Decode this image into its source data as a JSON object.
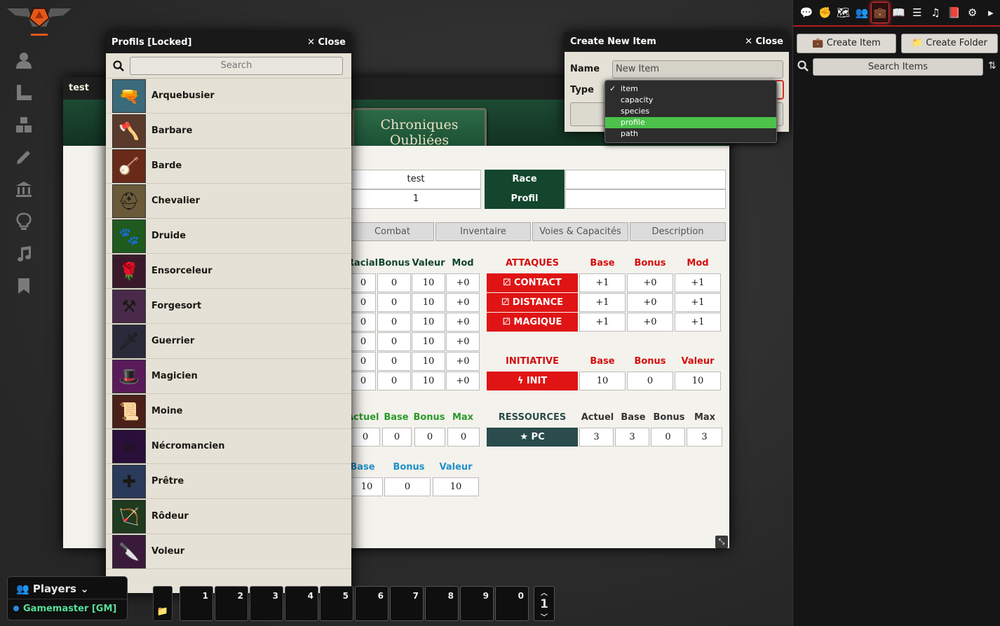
{
  "colors": {
    "accent_red": "#d40e0e",
    "sheet_green": "#13462d",
    "selected_green": "#4cc24a"
  },
  "sheet": {
    "title": "test",
    "logo_line1": "Chroniques",
    "logo_line2": "Oubliées",
    "name_value": "test",
    "level_value": "1",
    "race_label": "Race",
    "profil_label": "Profil",
    "race_value": "",
    "profil_value": "",
    "tabs": [
      "Combat",
      "Inventaire",
      "Voies & Capacités",
      "Description"
    ],
    "stats_headers": [
      "Racial",
      "Bonus",
      "Valeur",
      "Mod"
    ],
    "stats_rows": [
      [
        "0",
        "0",
        "10",
        "+0"
      ],
      [
        "0",
        "0",
        "10",
        "+0"
      ],
      [
        "0",
        "0",
        "10",
        "+0"
      ],
      [
        "0",
        "0",
        "10",
        "+0"
      ],
      [
        "0",
        "0",
        "10",
        "+0"
      ],
      [
        "0",
        "0",
        "10",
        "+0"
      ]
    ],
    "attack_headers": {
      "title": "ATTAQUES",
      "base": "Base",
      "bonus": "Bonus",
      "mod": "Mod"
    },
    "attacks": [
      {
        "label": "CONTACT",
        "base": "+1",
        "bonus": "+0",
        "mod": "+1"
      },
      {
        "label": "DISTANCE",
        "base": "+1",
        "bonus": "+0",
        "mod": "+1"
      },
      {
        "label": "MAGIQUE",
        "base": "+1",
        "bonus": "+0",
        "mod": "+1"
      }
    ],
    "init_headers": {
      "title": "INITIATIVE",
      "base": "Base",
      "bonus": "Bonus",
      "valeur": "Valeur"
    },
    "init": {
      "label": "INIT",
      "base": "10",
      "bonus": "0",
      "valeur": "10"
    },
    "hp_headers": [
      "Actuel",
      "Base",
      "Bonus",
      "Max"
    ],
    "hp_values": [
      "0",
      "0",
      "0",
      "0"
    ],
    "res_headers": {
      "title": "RESSOURCES",
      "actuel": "Actuel",
      "base": "Base",
      "bonus": "Bonus",
      "max": "Max"
    },
    "res": {
      "label": "PC",
      "actuel": "3",
      "base": "3",
      "bonus": "0",
      "max": "3"
    },
    "def_headers": [
      "Base",
      "Bonus",
      "Valeur"
    ],
    "def_values": [
      "10",
      "0",
      "10"
    ]
  },
  "profils": {
    "title": "Profils [Locked]",
    "close": "Close",
    "search_placeholder": "Search",
    "items": [
      {
        "name": "Arquebusier",
        "icon": "pistol-icon",
        "glyph": "🔫",
        "color": "#3b6a7a"
      },
      {
        "name": "Barbare",
        "icon": "axe-icon",
        "glyph": "🪓",
        "color": "#5a3a2a"
      },
      {
        "name": "Barde",
        "icon": "lute-icon",
        "glyph": "🪕",
        "color": "#6a2a1a"
      },
      {
        "name": "Chevalier",
        "icon": "helmet-icon",
        "glyph": "⛑",
        "color": "#6a5a3a"
      },
      {
        "name": "Druide",
        "icon": "paw-icon",
        "glyph": "🐾",
        "color": "#1f5a1f"
      },
      {
        "name": "Ensorceleur",
        "icon": "rose-staff-icon",
        "glyph": "🌹",
        "color": "#3a1a2a"
      },
      {
        "name": "Forgesort",
        "icon": "anvil-icon",
        "glyph": "⚒",
        "color": "#4a2a4a"
      },
      {
        "name": "Guerrier",
        "icon": "sword-icon",
        "glyph": "🗡",
        "color": "#2a2a3a"
      },
      {
        "name": "Magicien",
        "icon": "wizard-hat-icon",
        "glyph": "🎩",
        "color": "#5a1a5a"
      },
      {
        "name": "Moine",
        "icon": "scroll-icon",
        "glyph": "📜",
        "color": "#4a2018"
      },
      {
        "name": "Nécromancien",
        "icon": "dark-staff-icon",
        "glyph": "☠",
        "color": "#2a0f3a"
      },
      {
        "name": "Prêtre",
        "icon": "mace-icon",
        "glyph": "✚",
        "color": "#2a3a5a"
      },
      {
        "name": "Rôdeur",
        "icon": "bow-icon",
        "glyph": "🏹",
        "color": "#1f3a1f"
      },
      {
        "name": "Voleur",
        "icon": "dagger-icon",
        "glyph": "🔪",
        "color": "#3a1a3a"
      }
    ]
  },
  "create_item": {
    "title": "Create New Item",
    "close": "Close",
    "name_label": "Name",
    "name_value": "New Item",
    "type_label": "Type",
    "options": [
      "item",
      "capacity",
      "species",
      "profile",
      "path"
    ],
    "checked": "item",
    "highlighted": "profile"
  },
  "sidebar": {
    "tabs": [
      {
        "name": "chat-icon",
        "glyph": "💬"
      },
      {
        "name": "combat-fist-icon",
        "glyph": "✊"
      },
      {
        "name": "scenes-map-icon",
        "glyph": "🗺"
      },
      {
        "name": "actors-users-icon",
        "glyph": "👥"
      },
      {
        "name": "items-suitcase-icon",
        "glyph": "💼",
        "active": true
      },
      {
        "name": "journal-book-icon",
        "glyph": "📖"
      },
      {
        "name": "tables-list-icon",
        "glyph": "☰"
      },
      {
        "name": "playlists-music-icon",
        "glyph": "♫"
      },
      {
        "name": "compendium-atlas-icon",
        "glyph": "📕"
      },
      {
        "name": "settings-cogs-icon",
        "glyph": "⚙"
      },
      {
        "name": "collapse-arrow-icon",
        "glyph": "▸"
      }
    ],
    "create_item_label": "Create Item",
    "create_folder_label": "Create Folder",
    "search_placeholder": "Search Items"
  },
  "players": {
    "title": "Players",
    "user": "Gamemaster [GM]"
  },
  "hotbar": {
    "slots": [
      "1",
      "2",
      "3",
      "4",
      "5",
      "6",
      "7",
      "8",
      "9",
      "0"
    ],
    "page": "1"
  }
}
